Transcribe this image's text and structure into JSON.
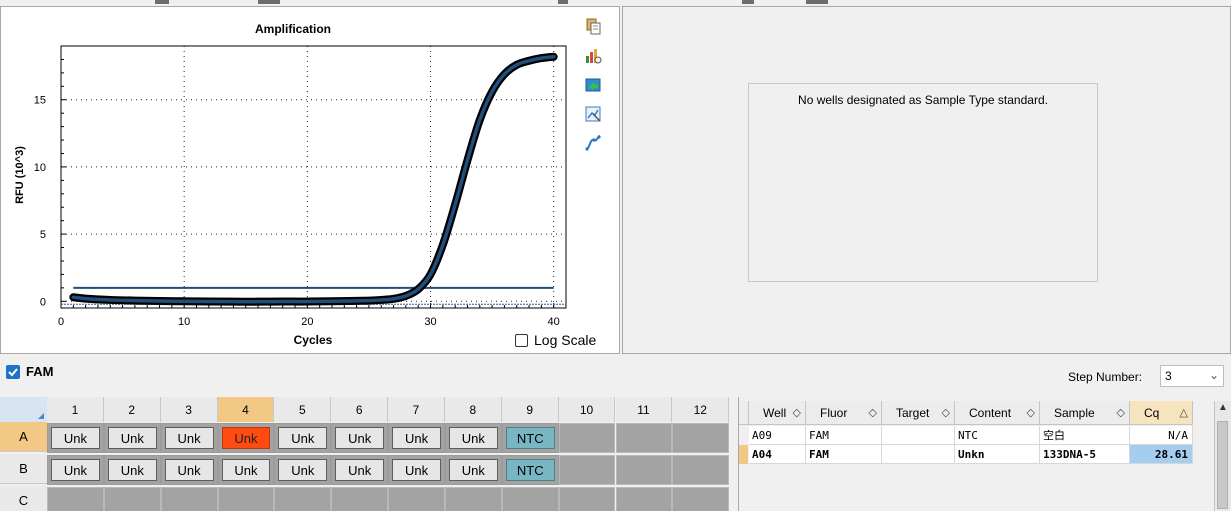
{
  "chart": {
    "title": "Amplification",
    "xlabel": "Cycles",
    "ylabel": "RFU (10^3)",
    "x_ticks": [
      "0",
      "10",
      "20",
      "30",
      "40"
    ],
    "y_ticks": [
      "0",
      "5",
      "10",
      "15"
    ],
    "log_scale_label": "Log Scale",
    "colors": {
      "curve": "#1f4f7a",
      "curve_outline": "#000000",
      "threshold": "#1f4f7a",
      "baseline": "#2d5c8a"
    }
  },
  "chart_data": {
    "type": "line",
    "title": "Amplification",
    "xlabel": "Cycles",
    "ylabel": "RFU (10^3)",
    "xlim": [
      0,
      41
    ],
    "ylim": [
      -0.5,
      19
    ],
    "grid": true,
    "series": [
      {
        "x": [
          1,
          2,
          4,
          6,
          8,
          10,
          12,
          14,
          16,
          18,
          20,
          22,
          24,
          25,
          26,
          27,
          28,
          29,
          30,
          31,
          32,
          33,
          34,
          35,
          36,
          37,
          38,
          39,
          40
        ],
        "values": [
          0.3,
          0.2,
          0.1,
          0.05,
          0.02,
          0.0,
          -0.02,
          -0.03,
          -0.03,
          -0.02,
          -0.02,
          0.0,
          0.03,
          0.05,
          0.1,
          0.18,
          0.4,
          0.9,
          2.0,
          4.2,
          7.2,
          10.5,
          13.5,
          15.6,
          16.9,
          17.6,
          17.9,
          18.1,
          18.2
        ]
      }
    ],
    "threshold": 1.0,
    "x_ticks": [
      0,
      10,
      20,
      30,
      40
    ],
    "y_ticks": [
      0,
      5,
      10,
      15
    ]
  },
  "side_icons": [
    "copy-icon",
    "chart-settings-icon",
    "export-icon",
    "zoom-icon",
    "curve-icon"
  ],
  "std_curve": {
    "message": "No wells designated as Sample Type standard."
  },
  "fluor": {
    "name": "FAM",
    "checked": true,
    "check_color": "#1e73c9"
  },
  "step": {
    "label": "Step Number:",
    "value": "3"
  },
  "plate": {
    "columns": [
      "1",
      "2",
      "3",
      "4",
      "5",
      "6",
      "7",
      "8",
      "9",
      "10",
      "11",
      "12"
    ],
    "selected_column": "4",
    "rows": [
      {
        "label": "A",
        "selected": true,
        "wells": [
          "Unk",
          "Unk",
          "Unk",
          "Unk",
          "Unk",
          "Unk",
          "Unk",
          "Unk",
          "NTC",
          "",
          "",
          ""
        ]
      },
      {
        "label": "B",
        "selected": false,
        "wells": [
          "Unk",
          "Unk",
          "Unk",
          "Unk",
          "Unk",
          "Unk",
          "Unk",
          "Unk",
          "NTC",
          "",
          "",
          ""
        ]
      },
      {
        "label": "C",
        "selected": false,
        "wells": [
          "",
          "",
          "",
          "",
          "",
          "",
          "",
          "",
          "",
          "",
          "",
          ""
        ]
      }
    ],
    "highlight_well": "A4",
    "colors": {
      "highlight": "#ff4a10",
      "ntc": "#79b6c4",
      "unk": "#e6e6e6"
    }
  },
  "results": {
    "headers": [
      "Well",
      "Fluor",
      "Target",
      "Content",
      "Sample",
      "Cq"
    ],
    "sorted_column": "Cq",
    "rows": [
      {
        "well": "A09",
        "fluor": "FAM",
        "target": "",
        "content": "NTC",
        "sample": "空白",
        "cq": "N/A",
        "bold": false
      },
      {
        "well": "A04",
        "fluor": "FAM",
        "target": "",
        "content": "Unkn",
        "sample": "133DNA-5",
        "cq": "28.61",
        "bold": true
      }
    ]
  }
}
